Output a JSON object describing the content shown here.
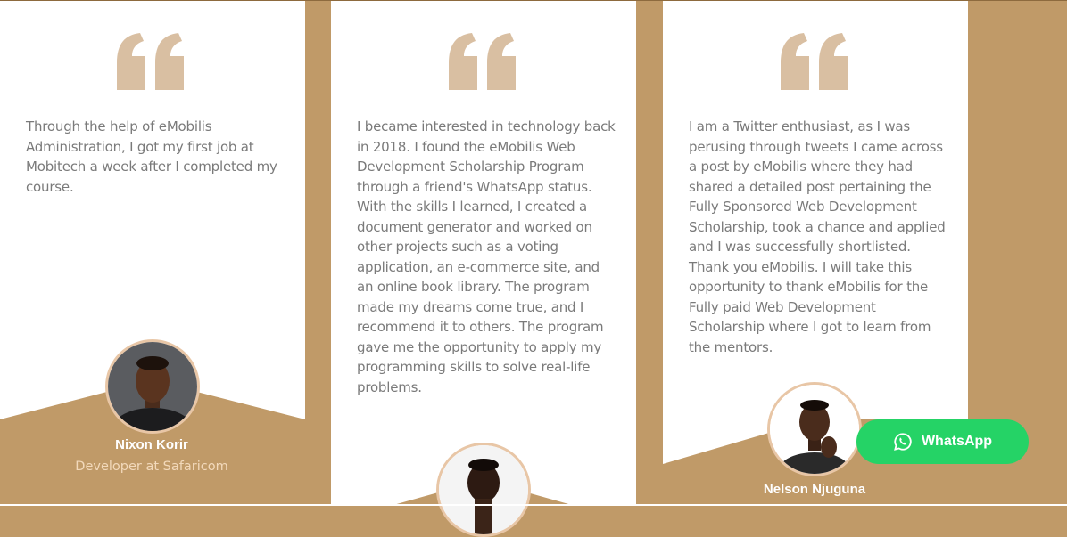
{
  "colors": {
    "accent": "#c09a68",
    "quote_icon": "#d9bfa2",
    "text_gray": "#7a7a7a",
    "role_text": "#f2d9bb",
    "whatsapp_green": "#25d366"
  },
  "testimonials": [
    {
      "quote_icon": "quote-icon",
      "text": "Through the help of eMobilis Administration, I got my first job at Mobitech a week after I completed my course.",
      "name": "Nixon Korir",
      "role": "Developer at Safaricom"
    },
    {
      "quote_icon": "quote-icon",
      "text": "I became interested in technology back in 2018. I found the eMobilis Web Development Scholarship Program through a friend's WhatsApp status. With the skills I learned, I created a document generator and worked on other projects such as a voting application, an e-commerce site, and an online book library. The program made my dreams come true, and I recommend it to others. The program gave me the opportunity to apply my programming skills to solve real-life problems."
    },
    {
      "quote_icon": "quote-icon",
      "text": "I am a Twitter enthusiast, as I was perusing through tweets I came across a post by eMobilis where they had shared a detailed post pertaining the Fully Sponsored Web Development Scholarship, took a chance and applied and I was successfully shortlisted. Thank you eMobilis. I will take this opportunity to thank eMobilis for the Fully paid Web Development Scholarship where I got to learn from the mentors.",
      "name": "Nelson Njuguna"
    }
  ],
  "whatsapp_button": {
    "label": "WhatsApp",
    "icon": "whatsapp-icon"
  }
}
